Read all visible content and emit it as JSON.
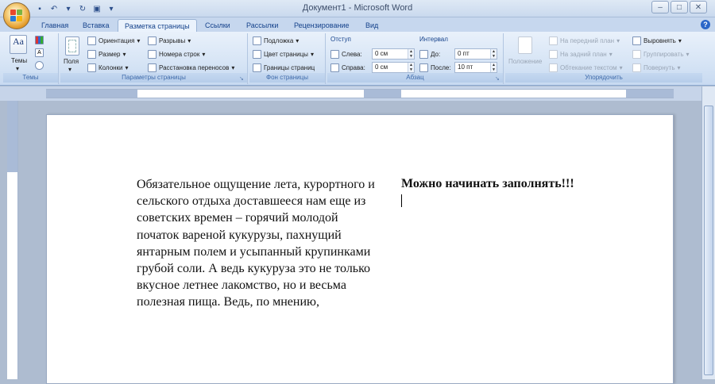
{
  "window": {
    "title": "Документ1 - Microsoft Word",
    "controls": [
      "–",
      "□",
      "✕"
    ]
  },
  "tabs": [
    "Главная",
    "Вставка",
    "Разметка страницы",
    "Ссылки",
    "Рассылки",
    "Рецензирование",
    "Вид"
  ],
  "active_tab": "Разметка страницы",
  "ribbon": {
    "themes": {
      "button": "Темы",
      "label": "Темы"
    },
    "page_setup": {
      "fields": "Поля",
      "orientation": "Ориентация",
      "size": "Размер",
      "columns": "Колонки",
      "breaks": "Разрывы",
      "line_numbers": "Номера строк",
      "hyphenation": "Расстановка переносов",
      "label": "Параметры страницы"
    },
    "page_background": {
      "watermark": "Подложка",
      "page_color": "Цвет страницы",
      "page_borders": "Границы страниц",
      "label": "Фон страницы"
    },
    "paragraph": {
      "indent_label": "Отступ",
      "left_label": "Слева:",
      "left_value": "0 см",
      "right_label": "Справа:",
      "right_value": "0 см",
      "spacing_label": "Интервал",
      "before_label": "До:",
      "before_value": "0 пт",
      "after_label": "После:",
      "after_value": "10 пт",
      "label": "Абзац"
    },
    "arrange": {
      "position": "Положение",
      "bring_front": "На передний план",
      "send_back": "На задний план",
      "text_wrap": "Обтекание текстом",
      "align": "Выровнять",
      "group": "Группировать",
      "rotate": "Повернуть",
      "label": "Упорядочить"
    }
  },
  "document": {
    "column1": "Обязательное ощущение лета, курортного и сельского отдыха доставшееся нам еще из советских времен – горячий молодой початок вареной кукурузы, пахнущий янтарным полем и усыпанный крупинками грубой соли. А ведь кукуруза это не только вкусное летнее лакомство, но и весьма полезная пища. Ведь, по мнению,",
    "column2": "Можно начинать заполнять!!!"
  }
}
